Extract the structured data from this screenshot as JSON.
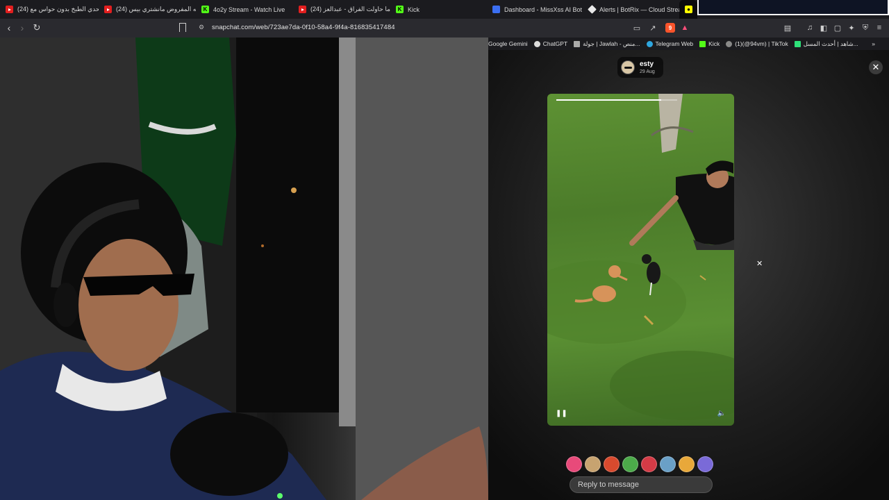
{
  "browser": {
    "tabs": [
      {
        "title": "(24) تحدي الطبخ بدون حواس مع",
        "favicon": "youtube"
      },
      {
        "title": "(24) ليه المفروض مانشتري بيس",
        "favicon": "youtube"
      },
      {
        "title": "4o2y Stream - Watch Live",
        "favicon": "kick"
      },
      {
        "title": "(24) ياما حاولت الفراق - عبدالعز",
        "favicon": "youtube"
      },
      {
        "title": "Kick",
        "favicon": "kick"
      },
      {
        "title": "Dashboard - MissXss AI Bot S",
        "favicon": "blue-globe"
      },
      {
        "title": "Alerts | BotRix — Cloud Strea",
        "favicon": "diamond"
      },
      {
        "title": "",
        "favicon": "snapchat"
      }
    ],
    "url": "snapchat.com/web/723ae7da-0f10-58a4-9f4a-816835417484",
    "bookmarks": [
      {
        "label": "Google Gemini"
      },
      {
        "label": "ChatGPT"
      },
      {
        "label": "جولة | Jawlah - منص..."
      },
      {
        "label": "Telegram Web"
      },
      {
        "label": "Kick"
      },
      {
        "label": "(1)(@94vm) | TikTok"
      },
      {
        "label": "شاهد | أحدث المسل..."
      }
    ],
    "more_bookmarks": "»",
    "shield_badge": "9"
  },
  "snap": {
    "username": "esty",
    "date": "29 Aug",
    "progress_fraction": 0.87,
    "reactions": [
      "heart-eyes",
      "laugh",
      "fire",
      "thumbs-up",
      "kiss",
      "sad",
      "wow",
      "purple"
    ],
    "reply_placeholder": "Reply to message"
  },
  "colors": {
    "accent_snap": "#fffc00",
    "kick_green": "#53fc18",
    "youtube_red": "#e21f1f"
  }
}
